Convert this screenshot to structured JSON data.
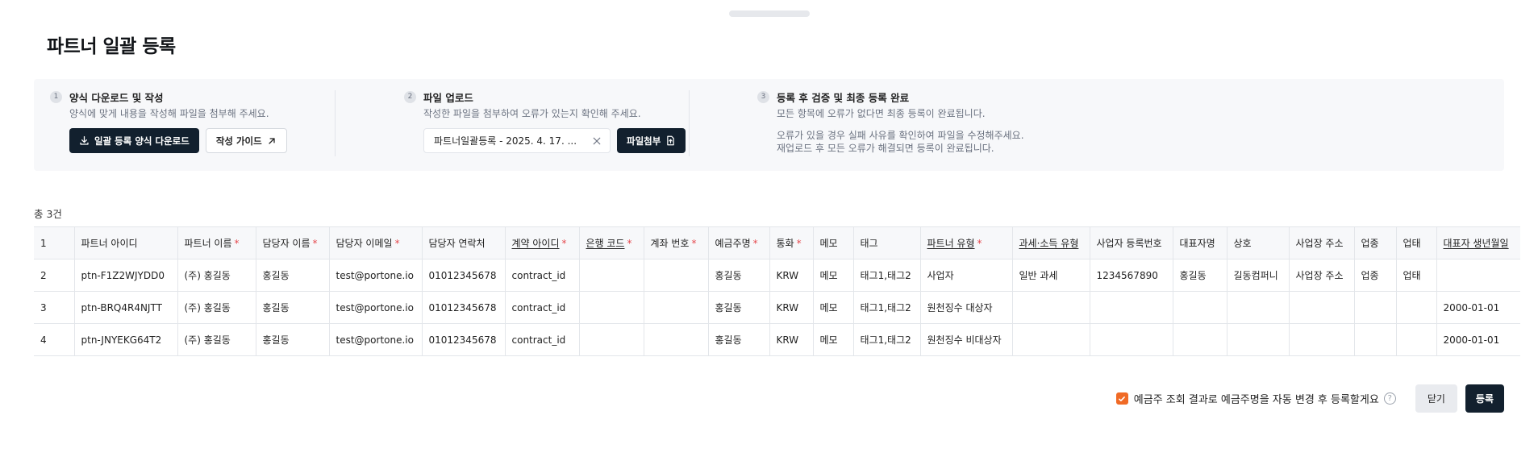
{
  "page": {
    "title": "파트너 일괄 등록"
  },
  "steps": [
    {
      "num": "1",
      "title": "양식 다운로드 및 작성",
      "desc": "양식에 맞게 내용을 작성해 파일을 첨부해 주세요.",
      "download_label": "일괄 등록 양식 다운로드",
      "guide_label": "작성 가이드"
    },
    {
      "num": "2",
      "title": "파일 업로드",
      "desc": "작성한 파일을 첨부하여 오류가 있는지 확인해 주세요.",
      "file_name": "파트너일괄등록 - 2025. 4. 17. ...",
      "attach_label": "파일첨부"
    },
    {
      "num": "3",
      "title": "등록 후 검증 및 최종 등록 완료",
      "desc": "모든 항목에 오류가 없다면 최종 등록이 완료됩니다.",
      "desc2": "오류가 있을 경우 실패 사유를 확인하여 파일을 수정해주세요.",
      "desc3": "재업로드 후 모든 오류가 해결되면 등록이 완료됩니다."
    }
  ],
  "table": {
    "total": "총 3건",
    "columns": [
      {
        "label": "1",
        "required": false,
        "underline": false
      },
      {
        "label": "파트너 아이디",
        "required": false,
        "underline": false
      },
      {
        "label": "파트너 이름",
        "required": true,
        "underline": false
      },
      {
        "label": "담당자 이름",
        "required": true,
        "underline": false
      },
      {
        "label": "담당자 이메일",
        "required": true,
        "underline": false
      },
      {
        "label": "담당자 연락처",
        "required": false,
        "underline": false
      },
      {
        "label": "계약 아이디",
        "required": true,
        "underline": true
      },
      {
        "label": "은행 코드",
        "required": true,
        "underline": true
      },
      {
        "label": "계좌 번호",
        "required": true,
        "underline": false
      },
      {
        "label": "예금주명",
        "required": true,
        "underline": false
      },
      {
        "label": "통화",
        "required": true,
        "underline": false
      },
      {
        "label": "메모",
        "required": false,
        "underline": false
      },
      {
        "label": "태그",
        "required": false,
        "underline": false
      },
      {
        "label": "파트너 유형",
        "required": true,
        "underline": true
      },
      {
        "label": "과세·소득 유형",
        "required": false,
        "underline": true
      },
      {
        "label": "사업자 등록번호",
        "required": false,
        "underline": false
      },
      {
        "label": "대표자명",
        "required": false,
        "underline": false
      },
      {
        "label": "상호",
        "required": false,
        "underline": false
      },
      {
        "label": "사업장 주소",
        "required": false,
        "underline": false
      },
      {
        "label": "업종",
        "required": false,
        "underline": false
      },
      {
        "label": "업태",
        "required": false,
        "underline": false
      },
      {
        "label": "대표자 생년월일",
        "required": false,
        "underline": true
      }
    ],
    "rows": [
      [
        "2",
        "ptn-F1Z2WJYDD0",
        "(주) 홍길동",
        "홍길동",
        "test@portone.io",
        "01012345678",
        "contract_id",
        "",
        "",
        "홍길동",
        "KRW",
        "메모",
        "태그1,태그2",
        "사업자",
        "일반 과세",
        "1234567890",
        "홍길동",
        "길동컴퍼니",
        "사업장 주소",
        "업종",
        "업태",
        ""
      ],
      [
        "3",
        "ptn-BRQ4R4NJTT",
        "(주) 홍길동",
        "홍길동",
        "test@portone.io",
        "01012345678",
        "contract_id",
        "",
        "",
        "홍길동",
        "KRW",
        "메모",
        "태그1,태그2",
        "원천징수 대상자",
        "",
        "",
        "",
        "",
        "",
        "",
        "",
        "2000-01-01"
      ],
      [
        "4",
        "ptn-JNYEKG64T2",
        "(주) 홍길동",
        "홍길동",
        "test@portone.io",
        "01012345678",
        "contract_id",
        "",
        "",
        "홍길동",
        "KRW",
        "메모",
        "태그1,태그2",
        "원천징수 비대상자",
        "",
        "",
        "",
        "",
        "",
        "",
        "",
        "2000-01-01"
      ]
    ]
  },
  "footer": {
    "auto_rename_label": "예금주 조회 결과로 예금주명을 자동 변경 후 등록할게요",
    "auto_rename_checked": true,
    "close_label": "닫기",
    "register_label": "등록"
  },
  "colors": {
    "primary": "#12202e",
    "accent": "#f06a25",
    "required": "#e5484d"
  }
}
